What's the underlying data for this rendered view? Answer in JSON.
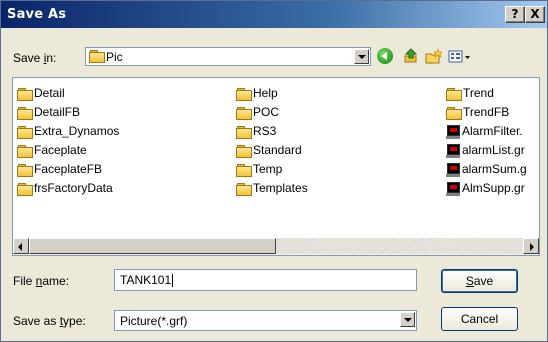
{
  "window": {
    "title": "Save As",
    "help_glyph": "?",
    "close_glyph": "X"
  },
  "save_in": {
    "label_pre": "Save ",
    "label_accel": "i",
    "label_post": "n:",
    "value": "Pic"
  },
  "files": {
    "items": [
      {
        "name": "Detail",
        "icon": "folder-icon"
      },
      {
        "name": "DetailFB",
        "icon": "folder-icon"
      },
      {
        "name": "Extra_Dynamos",
        "icon": "folder-icon"
      },
      {
        "name": "Faceplate",
        "icon": "folder-icon"
      },
      {
        "name": "FaceplateFB",
        "icon": "folder-icon"
      },
      {
        "name": "frsFactoryData",
        "icon": "folder-icon"
      },
      {
        "name": "Help",
        "icon": "folder-icon"
      },
      {
        "name": "POC",
        "icon": "folder-icon"
      },
      {
        "name": "RS3",
        "icon": "folder-icon"
      },
      {
        "name": "Standard",
        "icon": "folder-icon"
      },
      {
        "name": "Temp",
        "icon": "folder-icon"
      },
      {
        "name": "Templates",
        "icon": "folder-icon"
      },
      {
        "name": "Trend",
        "icon": "folder-icon"
      },
      {
        "name": "TrendFB",
        "icon": "folder-icon"
      },
      {
        "name": "AlarmFilter.",
        "icon": "graphic-file-icon"
      },
      {
        "name": "alarmList.gr",
        "icon": "graphic-file-icon"
      },
      {
        "name": "alarmSum.g",
        "icon": "graphic-file-icon"
      },
      {
        "name": "AlmSupp.gr",
        "icon": "graphic-file-icon"
      }
    ]
  },
  "file_name": {
    "label_pre": "File ",
    "label_accel": "n",
    "label_post": "ame:",
    "value": "TANK101"
  },
  "save_as_type": {
    "label_pre": "Save as ",
    "label_accel": "t",
    "label_post": "ype:",
    "value": "Picture(*.grf)"
  },
  "buttons": {
    "save_accel": "S",
    "save_rest": "ave",
    "cancel": "Cancel"
  }
}
